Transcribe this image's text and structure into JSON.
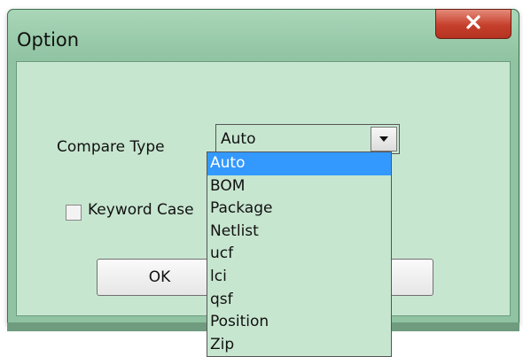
{
  "window": {
    "title": "Option",
    "close_label": "X"
  },
  "form": {
    "compare_type_label": "Compare Type",
    "compare_type_value": "Auto",
    "keyword_case_label": "Keyword Case",
    "keyword_case_checked": false
  },
  "buttons": {
    "ok_label": "OK",
    "cancel_label": ""
  },
  "dropdown": {
    "options": [
      "Auto",
      "BOM",
      "Package",
      "Netlist",
      "ucf",
      "lci",
      "qsf",
      "Position",
      "Zip"
    ],
    "selected_index": 0
  },
  "colors": {
    "window_background": "#8fc3a1",
    "client_background": "#c7e6d0",
    "selection": "#3399ff",
    "close_button": "#c5402c"
  }
}
